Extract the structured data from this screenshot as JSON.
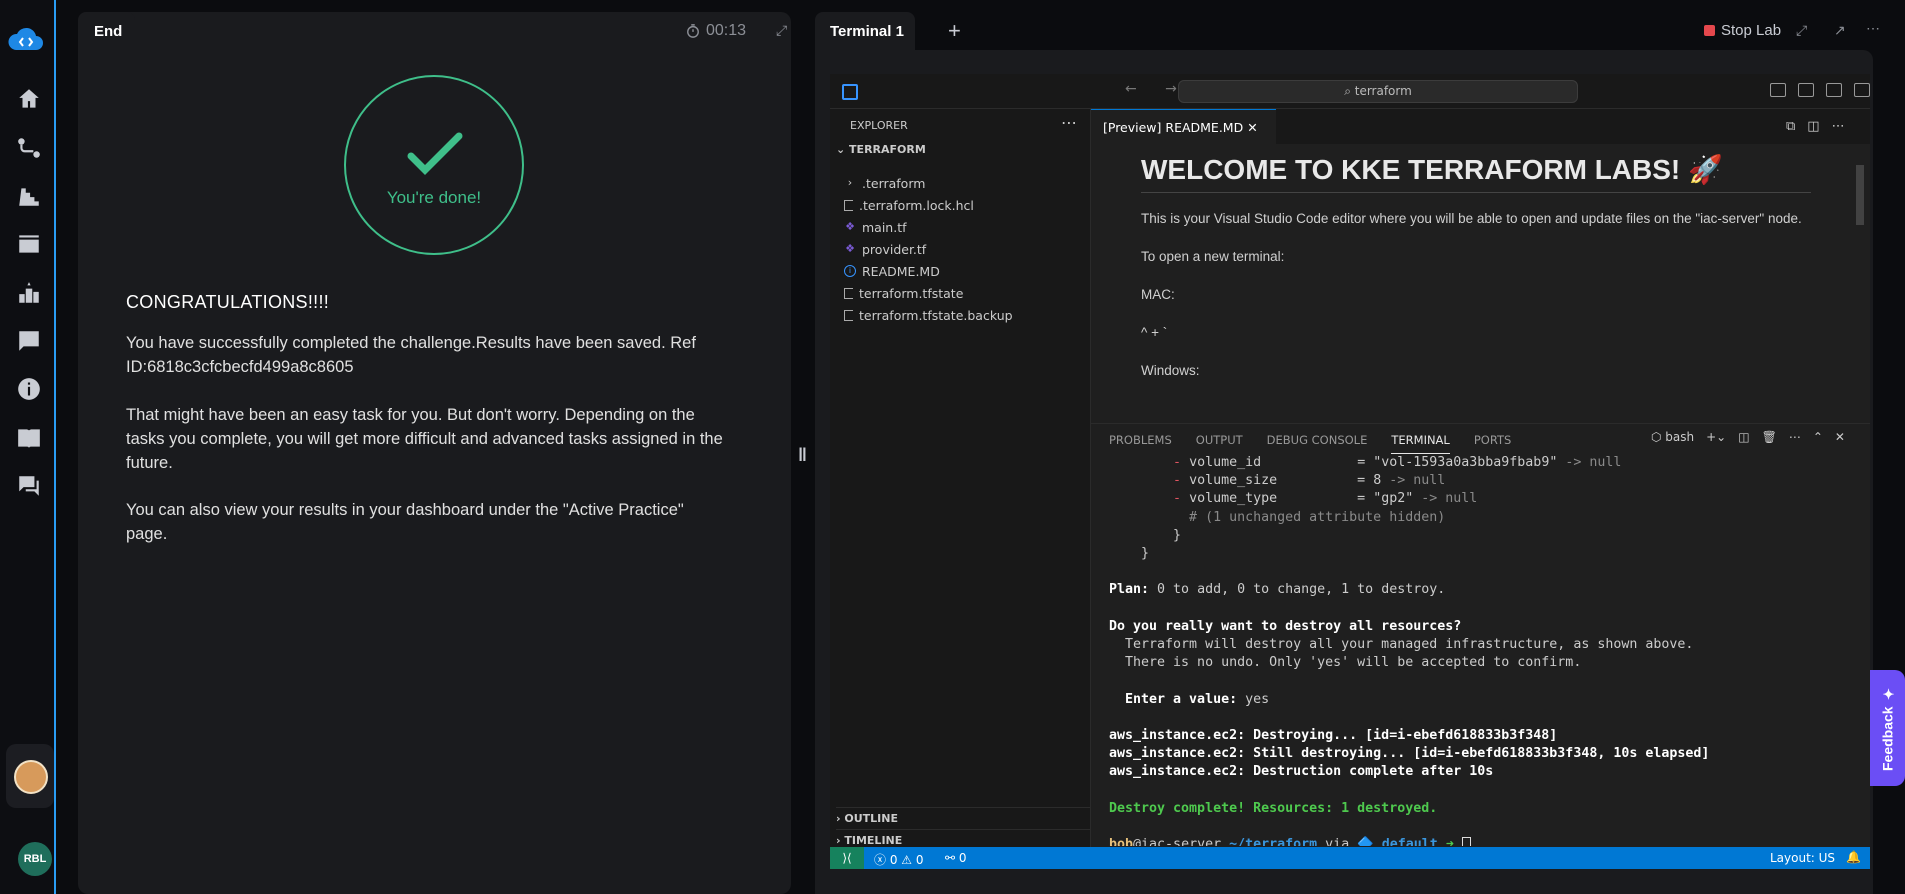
{
  "left_panel": {
    "tab_label": "End",
    "timer": "00:13",
    "done_text": "You're done!",
    "congrats": "CONGRATULATIONS!!!!",
    "para1": "You have successfully completed the challenge.Results have been saved. Ref ID:6818c3cfcbecfd499a8c8605",
    "para2": "That might have been an easy task for you. But don't worry. Depending on the tasks you complete, you will get more difficult and advanced tasks assigned in the future.",
    "para3": "You can also view your results in your dashboard under the \"Active Practice\" page."
  },
  "user": {
    "initials": "RBL"
  },
  "terminal_tab": {
    "label": "Terminal 1",
    "stop_label": "Stop Lab"
  },
  "vscode": {
    "search": "terraform",
    "explorer_title": "EXPLORER",
    "root": "TERRAFORM",
    "files": [
      {
        "name": ".terraform",
        "icon": "chevron-right-icon"
      },
      {
        "name": ".terraform.lock.hcl",
        "icon": "file-icon"
      },
      {
        "name": "main.tf",
        "icon": "terraform-icon"
      },
      {
        "name": "provider.tf",
        "icon": "terraform-icon"
      },
      {
        "name": "README.MD",
        "icon": "info-icon"
      },
      {
        "name": "terraform.tfstate",
        "icon": "file-icon"
      },
      {
        "name": "terraform.tfstate.backup",
        "icon": "file-icon"
      }
    ],
    "outline": "OUTLINE",
    "timeline": "TIMELINE",
    "editor_tab": "[Preview] README.MD",
    "readme": {
      "h1": "WELCOME TO KKE TERRAFORM LABS! 🚀",
      "p1": "This is your Visual Studio Code editor where you will be able to open and update files on the \"iac-server\" node.",
      "p2": "To open a new terminal:",
      "p3": "MAC:",
      "p4": "^ + `",
      "p5": "Windows:"
    },
    "panel_tabs": [
      "PROBLEMS",
      "OUTPUT",
      "DEBUG CONSOLE",
      "TERMINAL",
      "PORTS"
    ],
    "shell": "bash",
    "status": {
      "errors": "0",
      "warnings": "0",
      "ports": "0",
      "layout": "Layout: US"
    },
    "terminal_lines": {
      "l1a": "        - ",
      "l1b": "volume_id",
      "l1c": "            = \"vol-1593a0a3bba9fbab9\"",
      "l1d": " -> null",
      "l2b": "volume_size",
      "l2c": "          = 8",
      "l2d": " -> null",
      "l3b": "volume_type",
      "l3c": "          = \"gp2\"",
      "l3d": " -> null",
      "l4": "          # (1 unchanged attribute hidden)",
      "l5": "        }",
      "l6": "    }",
      "plan_a": "Plan:",
      "plan_b": " 0 to add, 0 to change, 1 to destroy.",
      "q": "Do you really want to destroy all resources?",
      "w1": "  Terraform will destroy all your managed infrastructure, as shown above.",
      "w2": "  There is no undo. Only 'yes' will be accepted to confirm.",
      "ev_a": "  Enter a value:",
      "ev_b": " yes",
      "d1": "aws_instance.ec2: Destroying... [id=i-ebefd618833b3f348]",
      "d2": "aws_instance.ec2: Still destroying... [id=i-ebefd618833b3f348, 10s elapsed]",
      "d3": "aws_instance.ec2: Destruction complete after 10s",
      "done": "Destroy complete! Resources: 1 destroyed.",
      "p_user": "bob",
      "p_host": "@iac-server",
      "p_dir": " ~/terraform",
      "p_via": " via ",
      "p_env": "🔷 default",
      "p_arrow": " ➜ "
    }
  },
  "feedback": "Feedback"
}
